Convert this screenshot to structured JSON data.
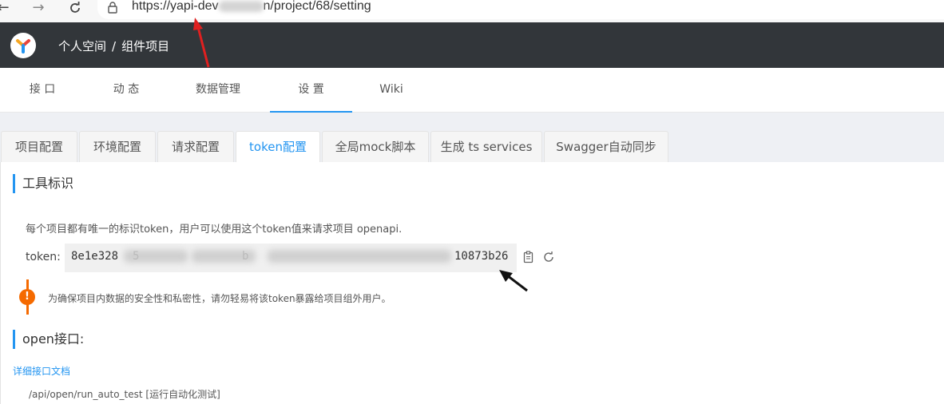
{
  "browser": {
    "url_prefix": "https://yapi-dev",
    "url_suffix": "n/project/68/setting"
  },
  "header": {
    "breadcrumb": [
      "个人空间",
      "组件项目"
    ],
    "separator": "/"
  },
  "nav_tabs": [
    "接 口",
    "动 态",
    "数据管理",
    "设 置",
    "Wiki"
  ],
  "nav_active": "设 置",
  "setting_tabs": [
    "项目配置",
    "环境配置",
    "请求配置",
    "token配置",
    "全局mock脚本",
    "生成 ts services",
    "Swagger自动同步"
  ],
  "setting_active": "token配置",
  "token_section": {
    "title": "工具标识",
    "description": "每个项目都有唯一的标识token，用户可以使用这个token值来请求项目 openapi.",
    "label": "token:",
    "token_start": "8e1e328",
    "token_mid1": "5",
    "token_mid2": "b",
    "token_end": "10873b26",
    "warning": "为确保项目内数据的安全性和私密性，请勿轻易将该token暴露给项目组外用户。"
  },
  "open_section": {
    "title": "open接口:",
    "doc_link": "详细接口文档",
    "api_path": "/api/open/run_auto_test [运行自动化测试]"
  },
  "colors": {
    "accent": "#2395f1",
    "header_bg": "#32363a",
    "warning": "#f56a00"
  }
}
